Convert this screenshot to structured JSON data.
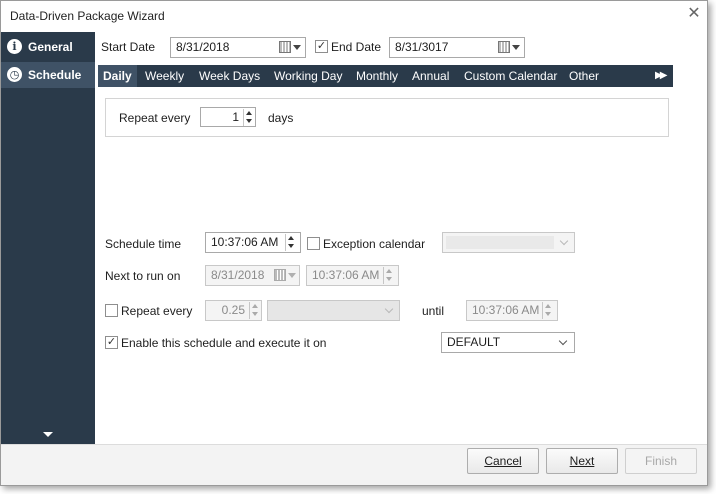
{
  "window": {
    "title": "Data-Driven Package Wizard",
    "close": "✕"
  },
  "sidebar": {
    "items": [
      {
        "label": "General",
        "icon": "info-icon",
        "glyph": "i"
      },
      {
        "label": "Schedule",
        "icon": "clock-icon",
        "glyph": "◷"
      }
    ]
  },
  "dates": {
    "start_label": "Start Date",
    "start_value": "8/31/2018",
    "end_label": "End Date",
    "end_checked": true,
    "end_value": "8/31/3017"
  },
  "tabs": [
    "Daily",
    "Weekly",
    "Week Days",
    "Working Day",
    "Monthly",
    "Annual",
    "Custom Calendar",
    "Other"
  ],
  "tab_more": "▶▶",
  "repeat": {
    "label": "Repeat every",
    "value": "1",
    "unit": "days"
  },
  "schedule": {
    "time_label": "Schedule time",
    "time_value": "10:37:06 AM",
    "exception_label": "Exception calendar",
    "exception_checked": false,
    "exception_value": "",
    "next_label": "Next to run on",
    "next_date": "8/31/2018",
    "next_time": "10:37:06 AM",
    "repeat_every_label": "Repeat every",
    "repeat_every_checked": false,
    "repeat_every_value": "0.25",
    "repeat_every_unit": "",
    "until_label": "until",
    "until_value": "10:37:06 AM",
    "enable_label": "Enable this schedule and execute it on",
    "enable_checked": true,
    "enable_value": "DEFAULT"
  },
  "footer": {
    "cancel_label": "Cancel",
    "next_label": "Next",
    "finish_label": "Finish"
  }
}
